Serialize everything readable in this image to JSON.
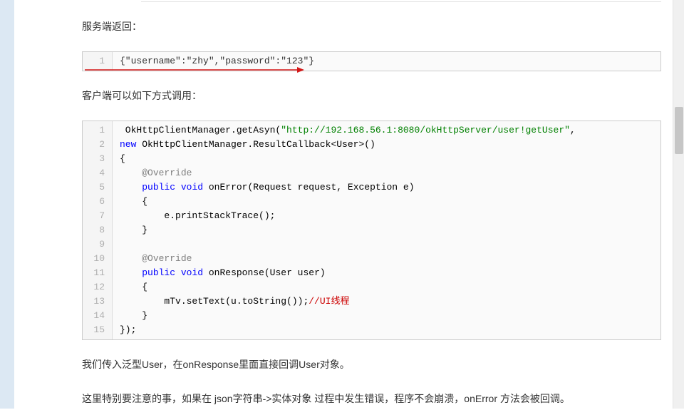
{
  "paragraphs": {
    "p1": "服务端返回：",
    "p2": "客户端可以如下方式调用：",
    "p3": "我们传入泛型User，在onResponse里面直接回调User对象。",
    "p4": "这里特别要注意的事，如果在 json字符串->实体对象 过程中发生错误，程序不会崩溃，onError 方法会被回调。"
  },
  "code1": {
    "lines": [
      {
        "num": "1",
        "text": "{\"username\":\"zhy\",\"password\":\"123\"}"
      }
    ]
  },
  "code2": {
    "lines": [
      {
        "num": "1",
        "tokens": [
          {
            "t": " OkHttpClientManager.getAsyn(",
            "cls": "tok-plain"
          },
          {
            "t": "\"http://192.168.56.1:8080/okHttpServer/user!getUser\"",
            "cls": "tok-string"
          },
          {
            "t": ",",
            "cls": "tok-plain"
          }
        ]
      },
      {
        "num": "2",
        "tokens": [
          {
            "t": "new",
            "cls": "tok-keyword"
          },
          {
            "t": " OkHttpClientManager.ResultCallback<User>()",
            "cls": "tok-plain"
          }
        ]
      },
      {
        "num": "3",
        "tokens": [
          {
            "t": "{",
            "cls": "tok-plain"
          }
        ]
      },
      {
        "num": "4",
        "tokens": [
          {
            "t": "    ",
            "cls": "tok-plain"
          },
          {
            "t": "@Override",
            "cls": "tok-anno"
          }
        ]
      },
      {
        "num": "5",
        "tokens": [
          {
            "t": "    ",
            "cls": "tok-plain"
          },
          {
            "t": "public",
            "cls": "tok-keyword"
          },
          {
            "t": " ",
            "cls": "tok-plain"
          },
          {
            "t": "void",
            "cls": "tok-keyword"
          },
          {
            "t": " onError(Request request, Exception e)",
            "cls": "tok-plain"
          }
        ]
      },
      {
        "num": "6",
        "tokens": [
          {
            "t": "    {",
            "cls": "tok-plain"
          }
        ]
      },
      {
        "num": "7",
        "tokens": [
          {
            "t": "        e.printStackTrace();",
            "cls": "tok-plain"
          }
        ]
      },
      {
        "num": "8",
        "tokens": [
          {
            "t": "    }",
            "cls": "tok-plain"
          }
        ]
      },
      {
        "num": "9",
        "tokens": [
          {
            "t": "",
            "cls": "tok-plain"
          }
        ]
      },
      {
        "num": "10",
        "tokens": [
          {
            "t": "    ",
            "cls": "tok-plain"
          },
          {
            "t": "@Override",
            "cls": "tok-anno"
          }
        ]
      },
      {
        "num": "11",
        "tokens": [
          {
            "t": "    ",
            "cls": "tok-plain"
          },
          {
            "t": "public",
            "cls": "tok-keyword"
          },
          {
            "t": " ",
            "cls": "tok-plain"
          },
          {
            "t": "void",
            "cls": "tok-keyword"
          },
          {
            "t": " onResponse(User user)",
            "cls": "tok-plain"
          }
        ]
      },
      {
        "num": "12",
        "tokens": [
          {
            "t": "    {",
            "cls": "tok-plain"
          }
        ]
      },
      {
        "num": "13",
        "tokens": [
          {
            "t": "        mTv.setText(u.toString());",
            "cls": "tok-plain"
          },
          {
            "t": "//UI线程",
            "cls": "tok-comment"
          }
        ]
      },
      {
        "num": "14",
        "tokens": [
          {
            "t": "    }",
            "cls": "tok-plain"
          }
        ]
      },
      {
        "num": "15",
        "tokens": [
          {
            "t": "});",
            "cls": "tok-plain"
          }
        ]
      }
    ]
  }
}
